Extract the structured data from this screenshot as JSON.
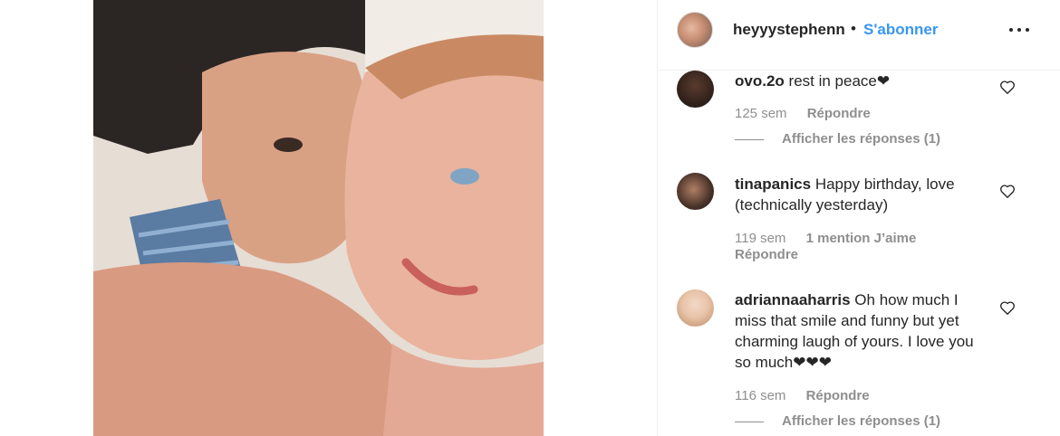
{
  "post": {
    "username": "heyyystephenn",
    "separator": "•",
    "follow_label": "S'abonner",
    "more_icon": "more-options-icon"
  },
  "comments": [
    {
      "username": "ovo.2o",
      "text": "rest in peace❤",
      "time": "125 sem",
      "reply_label": "Répondre",
      "view_replies": "Afficher les réponses (1)"
    },
    {
      "username": "tinapanics",
      "text": "Happy birthday, love (technically yesterday)",
      "time": "119 sem",
      "likes": "1 mention J’aime",
      "reply_label": "Répondre"
    },
    {
      "username": "adriannaaharris",
      "text": "Oh how much I miss that smile and funny but yet charming laugh of yours. I love you so much❤❤❤",
      "time": "116 sem",
      "reply_label": "Répondre",
      "view_replies": "Afficher les réponses (1)"
    }
  ],
  "colors": {
    "link": "#3897f0",
    "text": "#262626",
    "secondary": "#8e8e8e",
    "border": "#efefef"
  }
}
